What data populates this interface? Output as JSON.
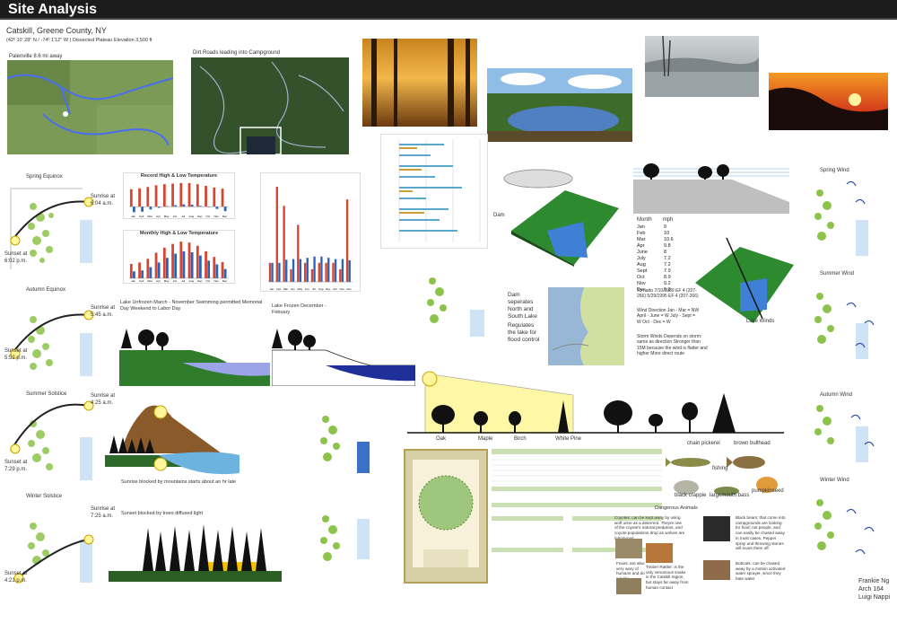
{
  "header": {
    "title": "Site Analysis"
  },
  "location": {
    "title": "Catskill, Greene County, NY",
    "coords": "(42º 10' 28'' N / -74º 1'12'' W )  Dissected Plateau",
    "elevation": "Elevation 3,500 ft"
  },
  "maps": {
    "map1_caption": "Palenville 8.6 mi away",
    "map2_caption": "Dirt Roads leading into Campground"
  },
  "sun_diagrams": {
    "left": [
      {
        "title": "Spring Equinox",
        "sunrise": "Sunrise at 6:04 a.m.",
        "sunset": "Sunset at 6:02 p.m."
      },
      {
        "title": "Autumn Equinox",
        "sunrise": "Sunrise at 5:45 a.m.",
        "sunset": "Sunset at 5:52 p.m."
      },
      {
        "title": "Summer Solstice",
        "sunrise": "Sunrise at 4:25 a.m.",
        "sunset": "Sunset at 7:29 p.m."
      },
      {
        "title": "Winter Solstice",
        "sunrise": "Sunrise at 7:25 a.m.",
        "sunset": "Sunset at 4:21 p.m."
      }
    ]
  },
  "wind_diagrams": {
    "labels": [
      "Spring Wind",
      "Summer Wind",
      "Autumn Wind",
      "Winter Wind"
    ]
  },
  "charts": {
    "record": {
      "title": "Record High & Low Temperature"
    },
    "monthly": {
      "title": "Monthly High & Low Temperature"
    }
  },
  "lake": {
    "unfrozen": "Lake Unfrozen March - November Swimming permitted Memorial Day Weekend to Labor Day",
    "frozen": "Lake Frozen December - Febuary"
  },
  "dam": {
    "text": "Dam seperates North and South Lake",
    "control": "Regulates the lake for flood control"
  },
  "models": {
    "label1": "Dam",
    "label2": "Lake Winds"
  },
  "wind_table": {
    "header": [
      "Month",
      "mph"
    ],
    "rows": [
      [
        "Jan",
        "9"
      ],
      [
        "Feb",
        "10"
      ],
      [
        "Mar",
        "10.6"
      ],
      [
        "Apr",
        "9.8"
      ],
      [
        "June",
        "8"
      ],
      [
        "July",
        "7.2"
      ],
      [
        "Aug",
        "7.2"
      ],
      [
        "Sept",
        "7.9"
      ],
      [
        "Oct",
        "8.9"
      ],
      [
        "Nov",
        "9.2"
      ],
      [
        "Dec",
        "9.3"
      ]
    ],
    "tornado": "Tornado 7/10/1989 EF 4 (207-266) 5/29/1995 EF 4 (207-266)",
    "direction": "Wind Direction Jan - Mar = NW April - June = W July - Sept = W Oct - Dec = W",
    "storm": "Storm Winds Depends on storm: same as direction Stronger than 15M because the wind is flatter and higher More direct route"
  },
  "trees": {
    "labels": [
      "Oak",
      "Maple",
      "Birch",
      "White Pine"
    ]
  },
  "captions": {
    "mountain": "Sunrise blocked by mountains starts about an hr late",
    "trees": "Sunset blocked by trees diffused light"
  },
  "fish": {
    "labels": [
      "chain pickerel",
      "brown bullhead",
      "fishing",
      "black crappie",
      "largemouth bass",
      "pumpkinseed"
    ]
  },
  "animals": {
    "title": "Dangerous Animals",
    "coyote": "Coyotes: can be kept away by using wolf urine as a deterrent. Theyre one of the coyote's natural predators, and coyote populations drop as wolves are introduced.",
    "bear": "Black bears: that come into campgrounds are looking for food; not people, and can easily be chased away in most cases. Pepper spray and throwing stones will scare them off.",
    "foxes": "Foxes: are also very wary of humans and do not like interaction.",
    "rattler": "Timber Rattler: is the only venomous snake in the Catskill region, but stays far away from human contact",
    "bobcat": "Bobcats: can be chased away by a motion activated water sprayer, since they hate water"
  },
  "credits": {
    "name": "Frankie Ng",
    "course": "Arch 164",
    "instructor": "Luigi Nappi"
  },
  "colors": {
    "header": "#1c1c1c",
    "grass": "#2e7d32",
    "lake": "#5b8fd6",
    "sun": "#fff59a"
  },
  "chart_data": [
    {
      "type": "bar",
      "title": "Record High & Low Temperature",
      "categories": [
        "Jan",
        "Feb",
        "Mar",
        "Apr",
        "May",
        "Jun",
        "Jul",
        "Aug",
        "Sep",
        "Oct",
        "Nov",
        "Dec"
      ],
      "series": [
        {
          "values": [
            62,
            65,
            70,
            76,
            80,
            82,
            84,
            84,
            80,
            74,
            68,
            64
          ]
        },
        {
          "values": [
            -20,
            -18,
            -10,
            -4,
            2,
            5,
            8,
            7,
            3,
            -2,
            -8,
            -16
          ]
        }
      ]
    },
    {
      "type": "bar",
      "title": "Monthly High & Low Temperature",
      "categories": [
        "Jan",
        "Feb",
        "Mar",
        "Apr",
        "May",
        "Jun",
        "Jul",
        "Aug",
        "Sep",
        "Oct",
        "Nov",
        "Dec"
      ],
      "series": [
        {
          "values": [
            31,
            34,
            42,
            55,
            66,
            74,
            79,
            77,
            70,
            58,
            46,
            35
          ]
        },
        {
          "values": [
            15,
            17,
            24,
            34,
            44,
            53,
            58,
            56,
            49,
            38,
            30,
            20
          ]
        }
      ]
    },
    {
      "type": "bar",
      "title": "",
      "categories": [
        "Jan",
        "Feb",
        "Mar",
        "Apr",
        "May",
        "Jun",
        "Jul",
        "Aug",
        "Sep",
        "Oct",
        "Nov",
        "Dec"
      ],
      "series": [
        {
          "values": [
            3,
            15,
            12,
            2,
            9,
            3,
            2,
            3,
            3,
            3,
            2,
            13
          ]
        },
        {
          "values": [
            3,
            3,
            3.5,
            3.6,
            3.6,
            3.8,
            4,
            4,
            3.8,
            3.6,
            3.6,
            3.4
          ]
        }
      ]
    }
  ]
}
